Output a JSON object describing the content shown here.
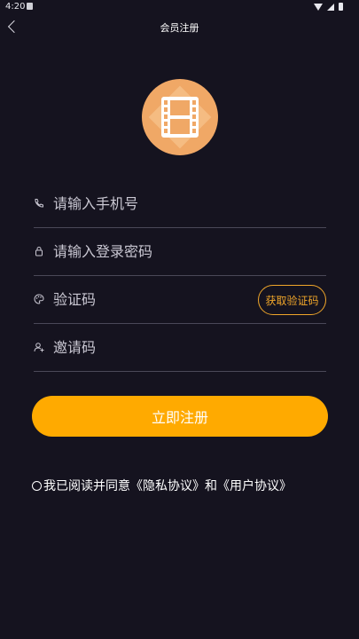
{
  "statusbar": {
    "time": "4:20"
  },
  "header": {
    "title": "会员注册"
  },
  "form": {
    "phone_placeholder": "请输入手机号",
    "password_placeholder": "请输入登录密码",
    "code_placeholder": "验证码",
    "get_code_label": "获取验证码",
    "invite_placeholder": "邀请码",
    "submit_label": "立即注册"
  },
  "agreement": {
    "prefix": "我已阅读并同意",
    "privacy_link": "《隐私协议》",
    "and": "和",
    "user_link": "《用户协议》"
  },
  "colors": {
    "background": "#15131f",
    "accent": "#ffaa00",
    "code_button": "#f0a62a",
    "logo": "#f0a866"
  },
  "icons": {
    "back": "chevron-left-icon",
    "logo": "film-icon",
    "phone": "phone-icon",
    "password": "lock-icon",
    "code": "palette-icon",
    "invite": "user-add-icon"
  }
}
